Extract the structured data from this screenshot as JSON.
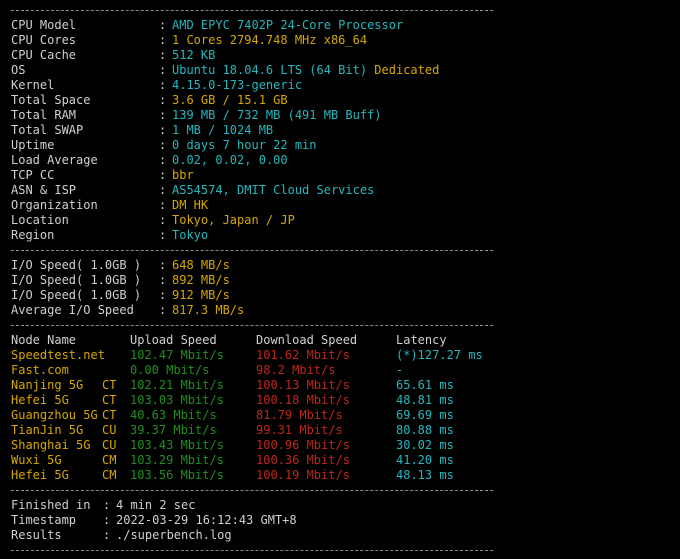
{
  "system": [
    {
      "label": "CPU Model",
      "value": "AMD EPYC 7402P 24-Core Processor",
      "color": "cyan"
    },
    {
      "label": "CPU Cores",
      "value": "1 Cores 2794.748 MHz x86_64",
      "color": "yellow"
    },
    {
      "label": "CPU Cache",
      "value": "512 KB",
      "color": "cyan"
    },
    {
      "label": "OS",
      "value": "Ubuntu 18.04.6 LTS (64 Bit)",
      "extra": " Dedicated",
      "color": "cyan"
    },
    {
      "label": "Kernel",
      "value": "4.15.0-173-generic",
      "color": "cyan"
    },
    {
      "label": "Total Space",
      "value": "3.6 GB / 15.1 GB",
      "color": "yellow"
    },
    {
      "label": "Total RAM",
      "value": "139 MB / 732 MB (491 MB Buff)",
      "color": "cyan"
    },
    {
      "label": "Total SWAP",
      "value": "1 MB / 1024 MB",
      "color": "cyan"
    },
    {
      "label": "Uptime",
      "value": "0 days 7 hour 22 min",
      "color": "cyan"
    },
    {
      "label": "Load Average",
      "value": "0.02, 0.02, 0.00",
      "color": "cyan"
    },
    {
      "label": "TCP CC",
      "value": "bbr",
      "color": "yellow"
    },
    {
      "label": "ASN & ISP",
      "value": "AS54574, DMIT Cloud Services",
      "color": "cyan"
    },
    {
      "label": "Organization",
      "value": "DM HK",
      "color": "yellow"
    },
    {
      "label": "Location",
      "value": "Tokyo, Japan / JP",
      "color": "yellow"
    },
    {
      "label": "Region",
      "value": "Tokyo",
      "color": "cyan"
    }
  ],
  "io": [
    {
      "label": "I/O Speed( 1.0GB )",
      "value": "648 MB/s"
    },
    {
      "label": "I/O Speed( 1.0GB )",
      "value": "892 MB/s"
    },
    {
      "label": "I/O Speed( 1.0GB )",
      "value": "912 MB/s"
    },
    {
      "label": "Average I/O Speed",
      "value": "817.3 MB/s"
    }
  ],
  "speed_header": {
    "node": "Node Name",
    "upload": "Upload Speed",
    "download": "Download Speed",
    "latency": "Latency"
  },
  "speed": [
    {
      "node": "Speedtest.net",
      "isp": "",
      "upload": "102.47 Mbit/s",
      "download": "101.62 Mbit/s",
      "latency": "(*)127.27 ms"
    },
    {
      "node": "Fast.com",
      "isp": "",
      "upload": "0.00 Mbit/s",
      "download": "98.2 Mbit/s",
      "latency": "-"
    },
    {
      "node": "Nanjing 5G",
      "isp": "CT",
      "upload": "102.21 Mbit/s",
      "download": "100.13 Mbit/s",
      "latency": "65.61 ms"
    },
    {
      "node": "Hefei 5G",
      "isp": "CT",
      "upload": "103.03 Mbit/s",
      "download": "100.18 Mbit/s",
      "latency": "48.81 ms"
    },
    {
      "node": "Guangzhou 5G",
      "isp": "CT",
      "upload": "40.63 Mbit/s",
      "download": "81.79 Mbit/s",
      "latency": "69.69 ms"
    },
    {
      "node": "TianJin 5G",
      "isp": "CU",
      "upload": "39.37 Mbit/s",
      "download": "99.31 Mbit/s",
      "latency": "80.88 ms"
    },
    {
      "node": "Shanghai 5G",
      "isp": "CU",
      "upload": "103.43 Mbit/s",
      "download": "100.96 Mbit/s",
      "latency": "30.02 ms"
    },
    {
      "node": "Wuxi 5G",
      "isp": "CM",
      "upload": "103.29 Mbit/s",
      "download": "100.36 Mbit/s",
      "latency": "41.20 ms"
    },
    {
      "node": "Hefei 5G",
      "isp": "CM",
      "upload": "103.56 Mbit/s",
      "download": "100.19 Mbit/s",
      "latency": "48.13 ms"
    }
  ],
  "footer": [
    {
      "label": "Finished in",
      "value": "4 min 2 sec"
    },
    {
      "label": "Timestamp",
      "value": "2022-03-29 16:12:43 GMT+8"
    },
    {
      "label": "Results",
      "value": "./superbench.log"
    }
  ],
  "colon": ":",
  "colors": {
    "cyan": "#24b7be",
    "yellow": "#d6a700",
    "green": "#13a10e",
    "red": "#c0261a",
    "background": "#000000"
  }
}
